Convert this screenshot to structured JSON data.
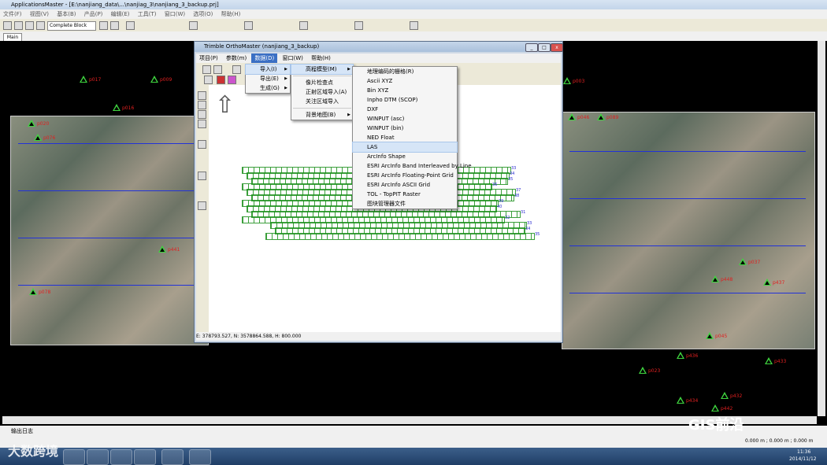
{
  "app": {
    "title": "ApplicationsMaster - [E:\\nanjiang_data\\...\\nanjiag_3\\nanjiang_3_backup.prj]"
  },
  "menu": [
    "文件(F)",
    "视图(V)",
    "基本(B)",
    "产品(P)",
    "编辑(E)",
    "工具(T)",
    "窗口(W)",
    "选项(O)",
    "帮助(H)"
  ],
  "toolbar": {
    "combo_value": "Complete Block"
  },
  "tab": {
    "main": "Main"
  },
  "gcps": [
    "p017",
    "p009",
    "p016",
    "p020",
    "p076",
    "p078",
    "p441",
    "p003",
    "p046",
    "p089",
    "p037",
    "p045",
    "p448",
    "p437",
    "p436",
    "p023",
    "p433",
    "p434",
    "p432",
    "p442",
    "p440",
    "p433"
  ],
  "log": {
    "label": "输出日志"
  },
  "statusbar": {
    "coords": "0.000 m ; 0.000 m ; 0.000 m"
  },
  "clock": {
    "time": "11:36",
    "date": "2014/11/12"
  },
  "watermark": {
    "brand": "GIS前沿",
    "left": "大数跨境"
  },
  "om": {
    "title": "Trimble OrthoMaster (nanjiang_3_backup)",
    "menu": [
      "项目(P)",
      "参数(m)",
      "数据(D)",
      "窗口(W)",
      "帮助(H)"
    ],
    "status": "E: 378793.527, N: 3578864.588, H: 800.000",
    "footprint_labels": [
      "33",
      "34",
      "35",
      "36",
      "37",
      "38",
      "39",
      "40",
      "31",
      "32",
      "33",
      "34",
      "35"
    ]
  },
  "data_menu": [
    "导入(I)",
    "导出(E)",
    "生成(G)"
  ],
  "import_menu": [
    "高程模型(M)",
    "像片检查点",
    "正射区域导入(A)",
    "关注区域导入",
    "背景地图(B)"
  ],
  "dem_menu": [
    "地理编码的栅格(R)",
    "Ascii XYZ",
    "Bin XYZ",
    "Inpho DTM (SCOP)",
    "DXF",
    "WINPUT (asc)",
    "WINPUT (bin)",
    "NED Float",
    "LAS",
    "ArcInfo Shape",
    "ESRI ArcInfo Band Interleaved by Line",
    "ESRI ArcInfo Floating-Point Grid",
    "ESRI ArcInfo ASCII Grid",
    "TOL - TopPIT Raster",
    "图块管理器文件"
  ],
  "highlight_item": "LAS"
}
